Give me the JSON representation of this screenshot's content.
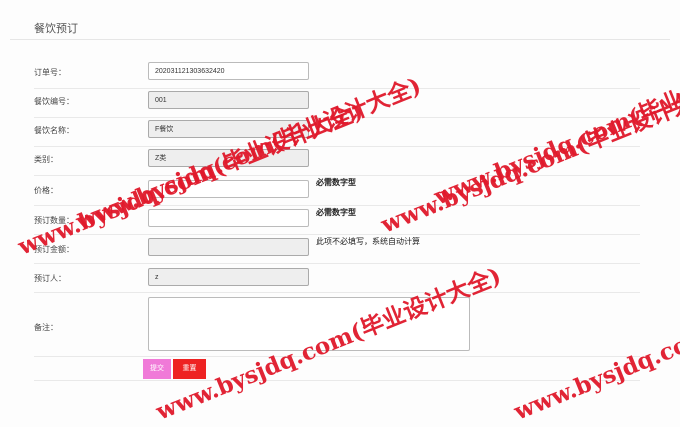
{
  "page": {
    "title": "餐饮预订"
  },
  "form": {
    "order_no": {
      "label": "订单号：",
      "value": "202031121303632420"
    },
    "catering_no": {
      "label": "餐饮编号：",
      "value": "001"
    },
    "catering_name": {
      "label": "餐饮名称：",
      "value": "F餐饮"
    },
    "category": {
      "label": "类别：",
      "value": "Z类"
    },
    "price": {
      "label": "价格：",
      "value": "",
      "hint": "必需数字型"
    },
    "quantity": {
      "label": "预订数量：",
      "value": "",
      "hint": "必需数字型"
    },
    "amount": {
      "label": "预订金额：",
      "value": "",
      "hint": "此项不必填写，系统自动计算"
    },
    "booker": {
      "label": "预订人：",
      "value": "z"
    },
    "remark": {
      "label": "备注：",
      "value": ""
    }
  },
  "buttons": {
    "submit": "提交",
    "reset": "重置"
  },
  "watermarks": [
    "www.bysjdq.com(毕业设计大全)",
    "www.bysjdq.com(毕业设计大全)",
    "www.bysjdq.com(毕业设计大全)",
    "www.bysjdq.com(毕业设计大全)",
    "www.bysjdq.com(毕业设计大全)",
    "www.bysjdq.com(毕业设计大全)"
  ]
}
